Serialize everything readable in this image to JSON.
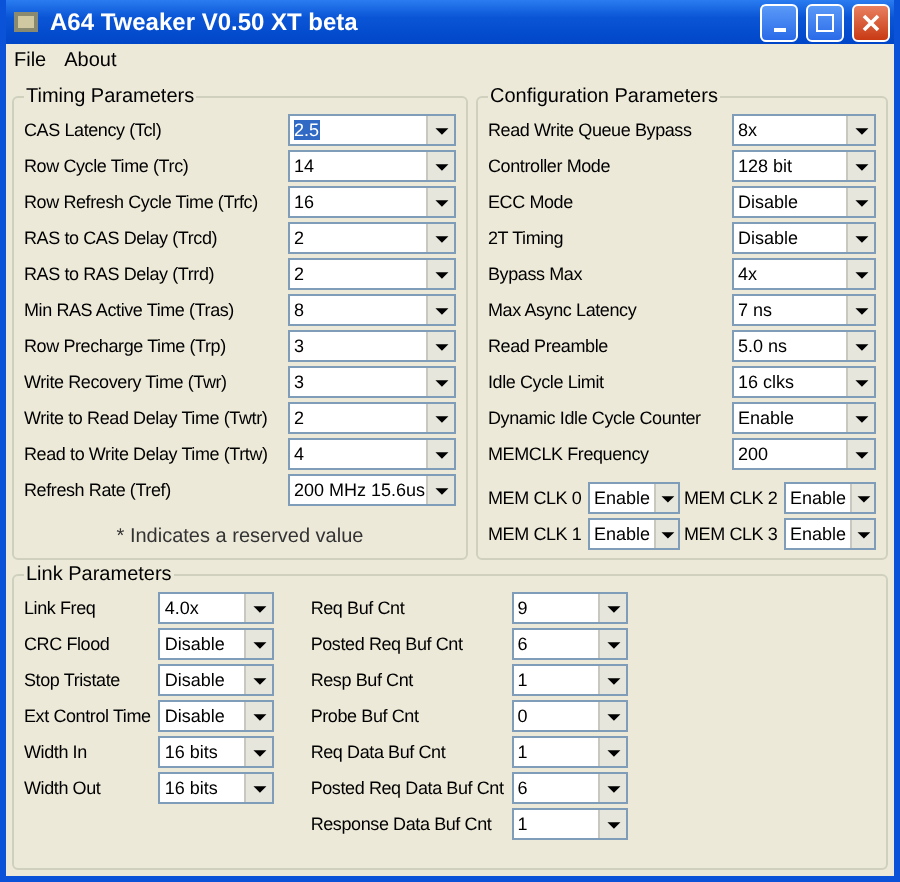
{
  "window": {
    "title": "A64 Tweaker V0.50 XT beta"
  },
  "menu": [
    "File",
    "About"
  ],
  "timing": {
    "title": "Timing Parameters",
    "rows": [
      {
        "label": "CAS Latency (Tcl)",
        "value": "2.5",
        "highlighted": true
      },
      {
        "label": "Row Cycle Time (Trc)",
        "value": "14",
        "highlighted": false
      },
      {
        "label": "Row Refresh Cycle Time (Trfc)",
        "value": "16",
        "highlighted": false
      },
      {
        "label": "RAS to CAS Delay (Trcd)",
        "value": "2",
        "highlighted": false
      },
      {
        "label": "RAS to RAS Delay (Trrd)",
        "value": "2",
        "highlighted": false
      },
      {
        "label": "Min RAS Active Time (Tras)",
        "value": "8",
        "highlighted": false
      },
      {
        "label": "Row Precharge Time (Trp)",
        "value": "3",
        "highlighted": false
      },
      {
        "label": "Write Recovery Time (Twr)",
        "value": "3",
        "highlighted": false
      },
      {
        "label": "Write to Read Delay Time (Twtr)",
        "value": "2",
        "highlighted": false
      },
      {
        "label": "Read to Write Delay Time (Trtw)",
        "value": "4",
        "highlighted": false
      },
      {
        "label": "Refresh Rate (Tref)",
        "value": "200 MHz 15.6us",
        "highlighted": false
      }
    ],
    "note": "* Indicates a reserved value"
  },
  "config": {
    "title": "Configuration Parameters",
    "rows": [
      {
        "label": "Read Write Queue Bypass",
        "value": "8x"
      },
      {
        "label": "Controller Mode",
        "value": "128 bit"
      },
      {
        "label": "ECC Mode",
        "value": "Disable"
      },
      {
        "label": "2T Timing",
        "value": "Disable"
      },
      {
        "label": "Bypass Max",
        "value": "4x"
      },
      {
        "label": "Max Async Latency",
        "value": "7 ns"
      },
      {
        "label": "Read Preamble",
        "value": "5.0 ns"
      },
      {
        "label": "Idle Cycle Limit",
        "value": "16 clks"
      },
      {
        "label": "Dynamic Idle Cycle Counter",
        "value": "Enable"
      },
      {
        "label": "MEMCLK Frequency",
        "value": "200"
      }
    ],
    "memclk": [
      {
        "label": "MEM CLK 0",
        "value": "Enable"
      },
      {
        "label": "MEM CLK 2",
        "value": "Enable"
      },
      {
        "label": "MEM CLK 1",
        "value": "Enable"
      },
      {
        "label": "MEM CLK 3",
        "value": "Enable"
      }
    ]
  },
  "link": {
    "title": "Link Parameters",
    "left": [
      {
        "label": "Link Freq",
        "value": "4.0x"
      },
      {
        "label": "CRC Flood",
        "value": "Disable"
      },
      {
        "label": "Stop Tristate",
        "value": "Disable"
      },
      {
        "label": "Ext Control Time",
        "value": "Disable"
      },
      {
        "label": "Width In",
        "value": "16 bits"
      },
      {
        "label": "Width Out",
        "value": "16 bits"
      }
    ],
    "right": [
      {
        "label": "Req Buf Cnt",
        "value": "9"
      },
      {
        "label": "Posted Req Buf Cnt",
        "value": "6"
      },
      {
        "label": "Resp Buf Cnt",
        "value": "1"
      },
      {
        "label": "Probe Buf Cnt",
        "value": "0"
      },
      {
        "label": "Req Data Buf Cnt",
        "value": "1"
      },
      {
        "label": "Posted Req Data Buf Cnt",
        "value": "6"
      },
      {
        "label": "Response Data Buf Cnt",
        "value": "1"
      }
    ]
  }
}
